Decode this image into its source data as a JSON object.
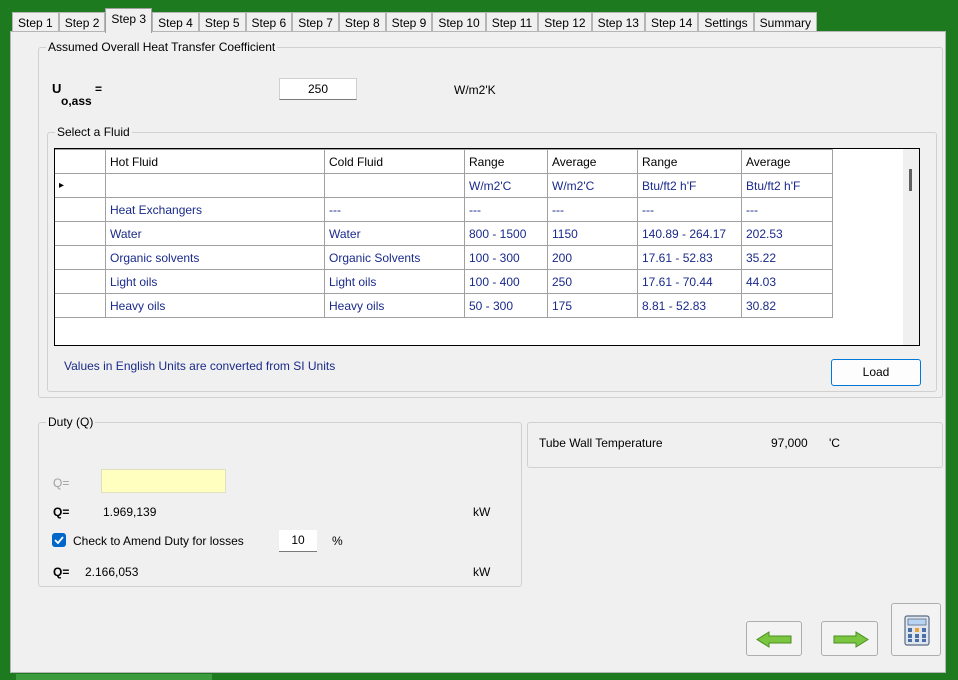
{
  "tabs": [
    "Step 1",
    "Step 2",
    "Step 3",
    "Step 4",
    "Step 5",
    "Step 6",
    "Step 7",
    "Step 8",
    "Step 9",
    "Step 10",
    "Step 11",
    "Step 12",
    "Step 13",
    "Step 14",
    "Settings",
    "Summary"
  ],
  "active_tab": "Step 3",
  "u_group": {
    "title": "Assumed Overall Heat Transfer Coefficient",
    "u_symbol": "U",
    "u_subscript": "o,ass",
    "equals": "=",
    "value": "250",
    "unit": "W/m2'K"
  },
  "fluid_group": {
    "title": "Select a Fluid",
    "headers": [
      "Hot Fluid",
      "Cold Fluid",
      "Range",
      "Average",
      "Range",
      "Average"
    ],
    "current_row_marker": "▸",
    "rows": [
      [
        "",
        "",
        "W/m2'C",
        "W/m2'C",
        "Btu/ft2 h'F",
        "Btu/ft2 h'F"
      ],
      [
        "Heat Exchangers",
        "---",
        "---",
        "---",
        "---",
        "---"
      ],
      [
        "Water",
        "Water",
        "800 - 1500",
        "1150",
        "140.89 - 264.17",
        "202.53"
      ],
      [
        "Organic solvents",
        "Organic Solvents",
        "100 - 300",
        "200",
        "17.61 - 52.83",
        "35.22"
      ],
      [
        "Light oils",
        "Light oils",
        "100 - 400",
        "250",
        "17.61 - 70.44",
        "44.03"
      ],
      [
        "Heavy oils",
        "Heavy oils",
        "50 - 300",
        "175",
        "8.81 - 52.83",
        "30.82"
      ]
    ],
    "note": "Values in English Units are converted from SI Units",
    "load_label": "Load"
  },
  "duty_group": {
    "title": "Duty (Q)",
    "q_input_label": "Q=",
    "q_input_value": "",
    "q_label": "Q=",
    "q_value": "1.969,139",
    "q_unit": "kW",
    "checkbox_checked": true,
    "checkbox_label": "Check to Amend Duty for losses",
    "loss_value": "10",
    "loss_unit": "%",
    "q2_label": "Q=",
    "q2_value": "2.166,053",
    "q2_unit": "kW"
  },
  "wall_group": {
    "label": "Tube Wall Temperature",
    "value": "97,000",
    "unit": "'C"
  },
  "colors": {
    "frame": "#1e7a1e",
    "panel": "#f0f0f0",
    "input_highlight": "#ffffc0",
    "arrow": "#7bc641",
    "accent": "#0078d7",
    "grid_text": "#1a2a8a"
  },
  "icons": [
    "back-arrow-icon",
    "forward-arrow-icon",
    "calculator-icon"
  ]
}
